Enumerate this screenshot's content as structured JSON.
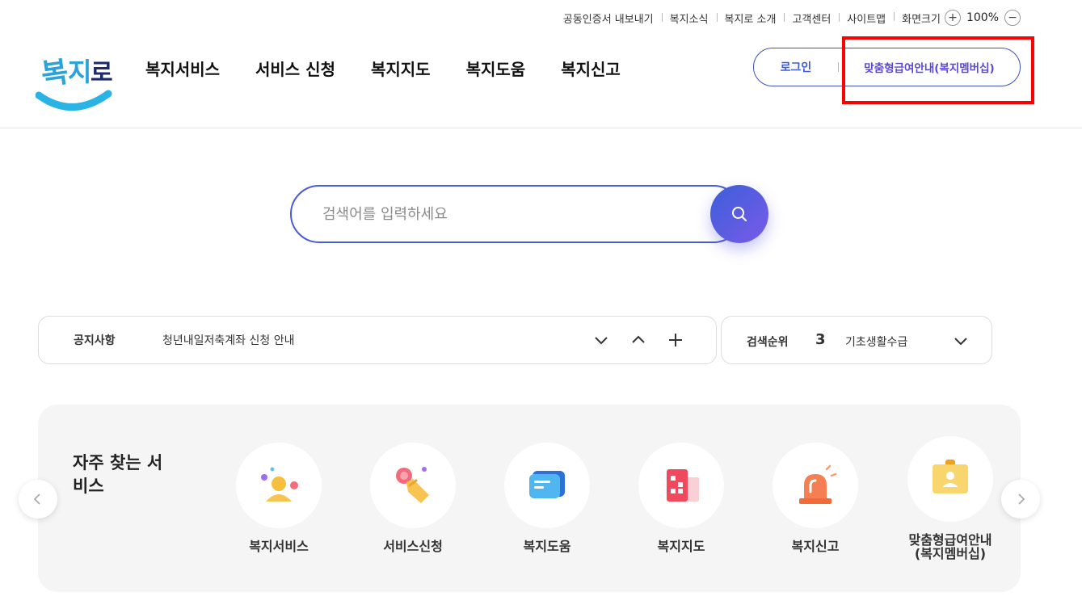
{
  "utility": {
    "links": [
      "공동인증서 내보내기",
      "복지소식",
      "복지로 소개",
      "고객센터",
      "사이트맵"
    ],
    "zoom_label": "화면크기",
    "zoom_in": "+",
    "zoom_value": "100%",
    "zoom_out": "−"
  },
  "logo": {
    "text": "복지로"
  },
  "nav": {
    "items": [
      "복지서비스",
      "서비스 신청",
      "복지지도",
      "복지도움",
      "복지신고"
    ]
  },
  "auth": {
    "login": "로그인",
    "member": "맞춤형급여안내(복지멤버십)"
  },
  "search": {
    "placeholder": "검색어를 입력하세요"
  },
  "notice": {
    "label": "공지사항",
    "text": "청년내일저축계좌 신청 안내"
  },
  "rank": {
    "label": "검색순위",
    "number": "3",
    "text": "기초생활수급"
  },
  "frequent": {
    "title": "자주 찾는 서비스",
    "items": [
      {
        "label": "복지서비스",
        "icon": "person-icon"
      },
      {
        "label": "서비스신청",
        "icon": "hand-click-icon"
      },
      {
        "label": "복지도움",
        "icon": "chat-card-icon"
      },
      {
        "label": "복지지도",
        "icon": "building-icon"
      },
      {
        "label": "복지신고",
        "icon": "siren-icon"
      },
      {
        "label": "맞춤형급여안내\n(복지멤버십)",
        "icon": "id-card-icon"
      }
    ]
  },
  "colors": {
    "accent": "#3f51b5",
    "highlight": "#ff0000",
    "search_gradient_start": "#3b5fd9",
    "search_gradient_end": "#7a5ae8"
  }
}
